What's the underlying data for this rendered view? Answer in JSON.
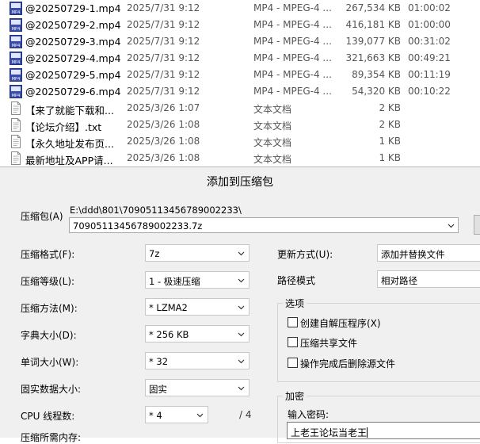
{
  "files": [
    {
      "name": "@20250729-1.mp4",
      "date": "2025/7/31 9:12",
      "type": "MP4 - MPEG-4 ...",
      "size": "267,534 KB",
      "duration": "01:00:02",
      "icon": "mp4-icon"
    },
    {
      "name": "@20250729-2.mp4",
      "date": "2025/7/31 9:12",
      "type": "MP4 - MPEG-4 ...",
      "size": "416,181 KB",
      "duration": "01:00:00",
      "icon": "mp4-icon"
    },
    {
      "name": "@20250729-3.mp4",
      "date": "2025/7/31 9:12",
      "type": "MP4 - MPEG-4 ...",
      "size": "139,077 KB",
      "duration": "00:31:02",
      "icon": "mp4-icon"
    },
    {
      "name": "@20250729-4.mp4",
      "date": "2025/7/31 9:12",
      "type": "MP4 - MPEG-4 ...",
      "size": "321,663 KB",
      "duration": "00:49:21",
      "icon": "mp4-icon"
    },
    {
      "name": "@20250729-5.mp4",
      "date": "2025/7/31 9:12",
      "type": "MP4 - MPEG-4 ...",
      "size": "89,354 KB",
      "duration": "00:11:19",
      "icon": "mp4-icon"
    },
    {
      "name": "@20250729-6.mp4",
      "date": "2025/7/31 9:12",
      "type": "MP4 - MPEG-4 ...",
      "size": "54,320 KB",
      "duration": "00:10:22",
      "icon": "mp4-icon"
    },
    {
      "name": "【来了就能下载和...",
      "date": "2025/3/26 1:07",
      "type": "文本文档",
      "size": "2 KB",
      "duration": "",
      "icon": "text-file-icon"
    },
    {
      "name": "【论坛介绍】.txt",
      "date": "2025/3/26 1:08",
      "type": "文本文档",
      "size": "2 KB",
      "duration": "",
      "icon": "text-file-icon"
    },
    {
      "name": "【永久地址发布页...",
      "date": "2025/3/26 1:08",
      "type": "文本文档",
      "size": "1 KB",
      "duration": "",
      "icon": "text-file-icon"
    },
    {
      "name": "最新地址及APP请...",
      "date": "2025/3/26 1:08",
      "type": "文本文档",
      "size": "1 KB",
      "duration": "",
      "icon": "text-file-icon"
    }
  ],
  "dialog": {
    "title": "添加到压缩包",
    "archive_label": "压缩包(A)",
    "archive_path": "E:\\ddd\\801\\70905113456789002233\\",
    "archive_name": "70905113456789002233.7z",
    "format_label": "压缩格式(F):",
    "format_value": "7z",
    "level_label": "压缩等级(L):",
    "level_value": "1 - 极速压缩",
    "method_label": "压缩方法(M):",
    "method_value": "* LZMA2",
    "dict_label": "字典大小(D):",
    "dict_value": "* 256 KB",
    "word_label": "单词大小(W):",
    "word_value": "* 32",
    "solid_label": "固实数据大小:",
    "solid_value": "固实",
    "threads_label": "CPU 线程数:",
    "threads_value": "* 4",
    "threads_total": "/ 4",
    "memory_label": "压缩所需内存:",
    "update_label": "更新方式(U):",
    "update_value": "添加并替换文件",
    "pathmode_label": "路径模式",
    "pathmode_value": "相对路径",
    "options_title": "选项",
    "opt_sfx": "创建自解压程序(X)",
    "opt_shared": "压缩共享文件",
    "opt_delete": "操作完成后删除源文件",
    "encrypt_title": "加密",
    "password_label": "输入密码:",
    "password_value": "上老王论坛当老王"
  },
  "colors": {
    "mp4_icon": "#3a4ea8",
    "dialog_bg": "#f0f0f0"
  }
}
